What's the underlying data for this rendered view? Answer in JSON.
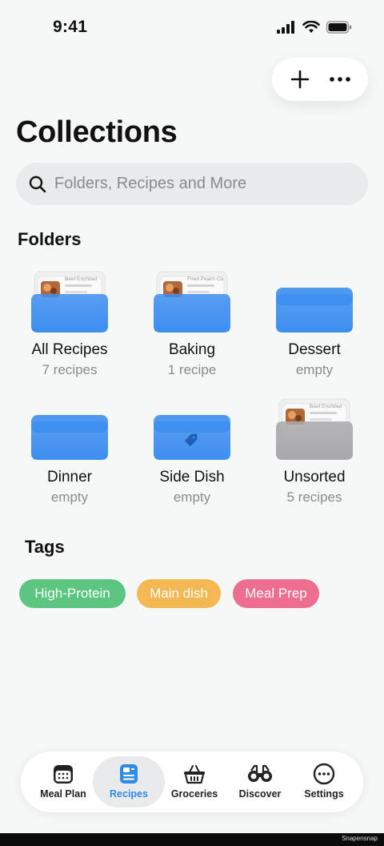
{
  "status": {
    "time": "9:41"
  },
  "header": {
    "title": "Collections"
  },
  "search": {
    "placeholder": "Folders, Recipes and More"
  },
  "folders_section": {
    "title": "Folders"
  },
  "folders": [
    {
      "name": "All Recipes",
      "count": "7 recipes",
      "preview": "Beef Enchilad",
      "type": "filled",
      "color": "#3d8ef0"
    },
    {
      "name": "Baking",
      "count": "1 recipe",
      "preview": "Fried Peach Co",
      "type": "filled",
      "color": "#3d8ef0"
    },
    {
      "name": "Dessert",
      "count": "empty",
      "type": "empty",
      "color": "#3d8ef0"
    },
    {
      "name": "Dinner",
      "count": "empty",
      "type": "empty",
      "color": "#3d8ef0"
    },
    {
      "name": "Side Dish",
      "count": "empty",
      "type": "tag",
      "color": "#3d8ef0"
    },
    {
      "name": "Unsorted",
      "count": "5 recipes",
      "preview": "Beef Enchilad",
      "type": "filled",
      "color": "#a9a9ab"
    }
  ],
  "tags_section": {
    "title": "Tags"
  },
  "tags": [
    {
      "label": "High-Protein",
      "color": "#5cc57f"
    },
    {
      "label": "Main dish",
      "color": "#f3b851"
    },
    {
      "label": "Meal Prep",
      "color": "#ee6e8f"
    }
  ],
  "tabs": [
    {
      "label": "Meal Plan",
      "icon": "calendar-icon"
    },
    {
      "label": "Recipes",
      "icon": "recipe-card-icon",
      "active": true
    },
    {
      "label": "Groceries",
      "icon": "basket-icon"
    },
    {
      "label": "Discover",
      "icon": "binoculars-icon"
    },
    {
      "label": "Settings",
      "icon": "more-circle-icon"
    }
  ],
  "watermark": "Snapensnap",
  "colors": {
    "accent": "#2f8be6",
    "background": "#f6f7f7"
  }
}
